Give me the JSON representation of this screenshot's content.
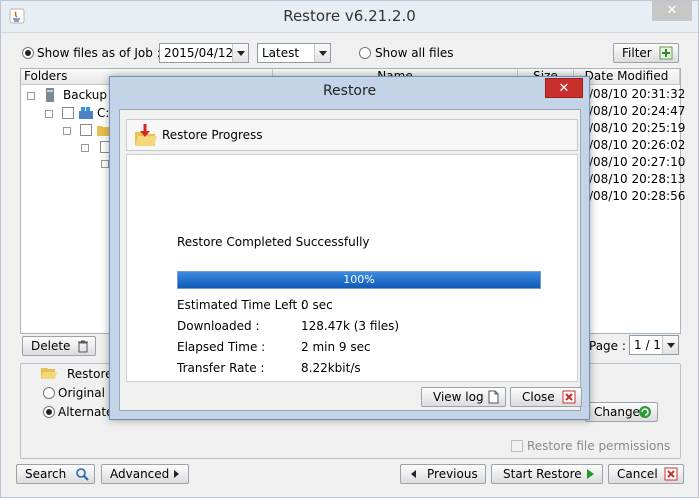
{
  "window": {
    "title": "Restore v6.21.2.0",
    "close_glyph": "✕"
  },
  "toolbar": {
    "show_files_as_of_label": "Show files as of Job :",
    "job_date": "2015/04/12",
    "job_version": "Latest",
    "show_all_files_label": "Show all files",
    "filter_label": "Filter"
  },
  "file_table": {
    "columns": [
      "Folders",
      "Name",
      "Size",
      "Date Modified"
    ],
    "tree_root_label": "Backup S",
    "tree_drive_label": "C:",
    "dates": [
      "/08/10 20:31:32",
      "/08/10 20:24:47",
      "/08/10 20:25:19",
      "/08/10 20:26:02",
      "/08/10 20:27:10",
      "/08/10 20:28:13",
      "/08/10 20:28:56"
    ]
  },
  "bottom_bar": {
    "delete_label": "Delete",
    "page_label": "Page :",
    "page_value": "1 / 1"
  },
  "restore_group": {
    "title": "Restore",
    "original_label": "Original lo",
    "alternate_label": "Alternate l",
    "change_label": "Change",
    "permissions_label": "Restore file permissions"
  },
  "footer": {
    "search_label": "Search",
    "advanced_label": "Advanced",
    "previous_label": "Previous",
    "start_restore_label": "Start Restore",
    "cancel_label": "Cancel"
  },
  "dialog": {
    "title": "Restore",
    "close_glyph": "✕",
    "header_label": "Restore Progress",
    "status": "Restore Completed Successfully",
    "progress_percent": 100,
    "progress_text": "100%",
    "stats": [
      {
        "label": "Estimated Time Left :",
        "value": "0 sec"
      },
      {
        "label": "Downloaded :",
        "value": "128.47k (3 files)"
      },
      {
        "label": "Elapsed Time :",
        "value": "2 min 9 sec"
      },
      {
        "label": "Transfer Rate :",
        "value": "8.22kbit/s"
      }
    ],
    "view_log_label": "View log",
    "close_label": "Close"
  },
  "colors": {
    "accent_blue": "#0d5ab6",
    "dialog_close_red": "#c9302c",
    "play_green": "#1f9a2a"
  }
}
